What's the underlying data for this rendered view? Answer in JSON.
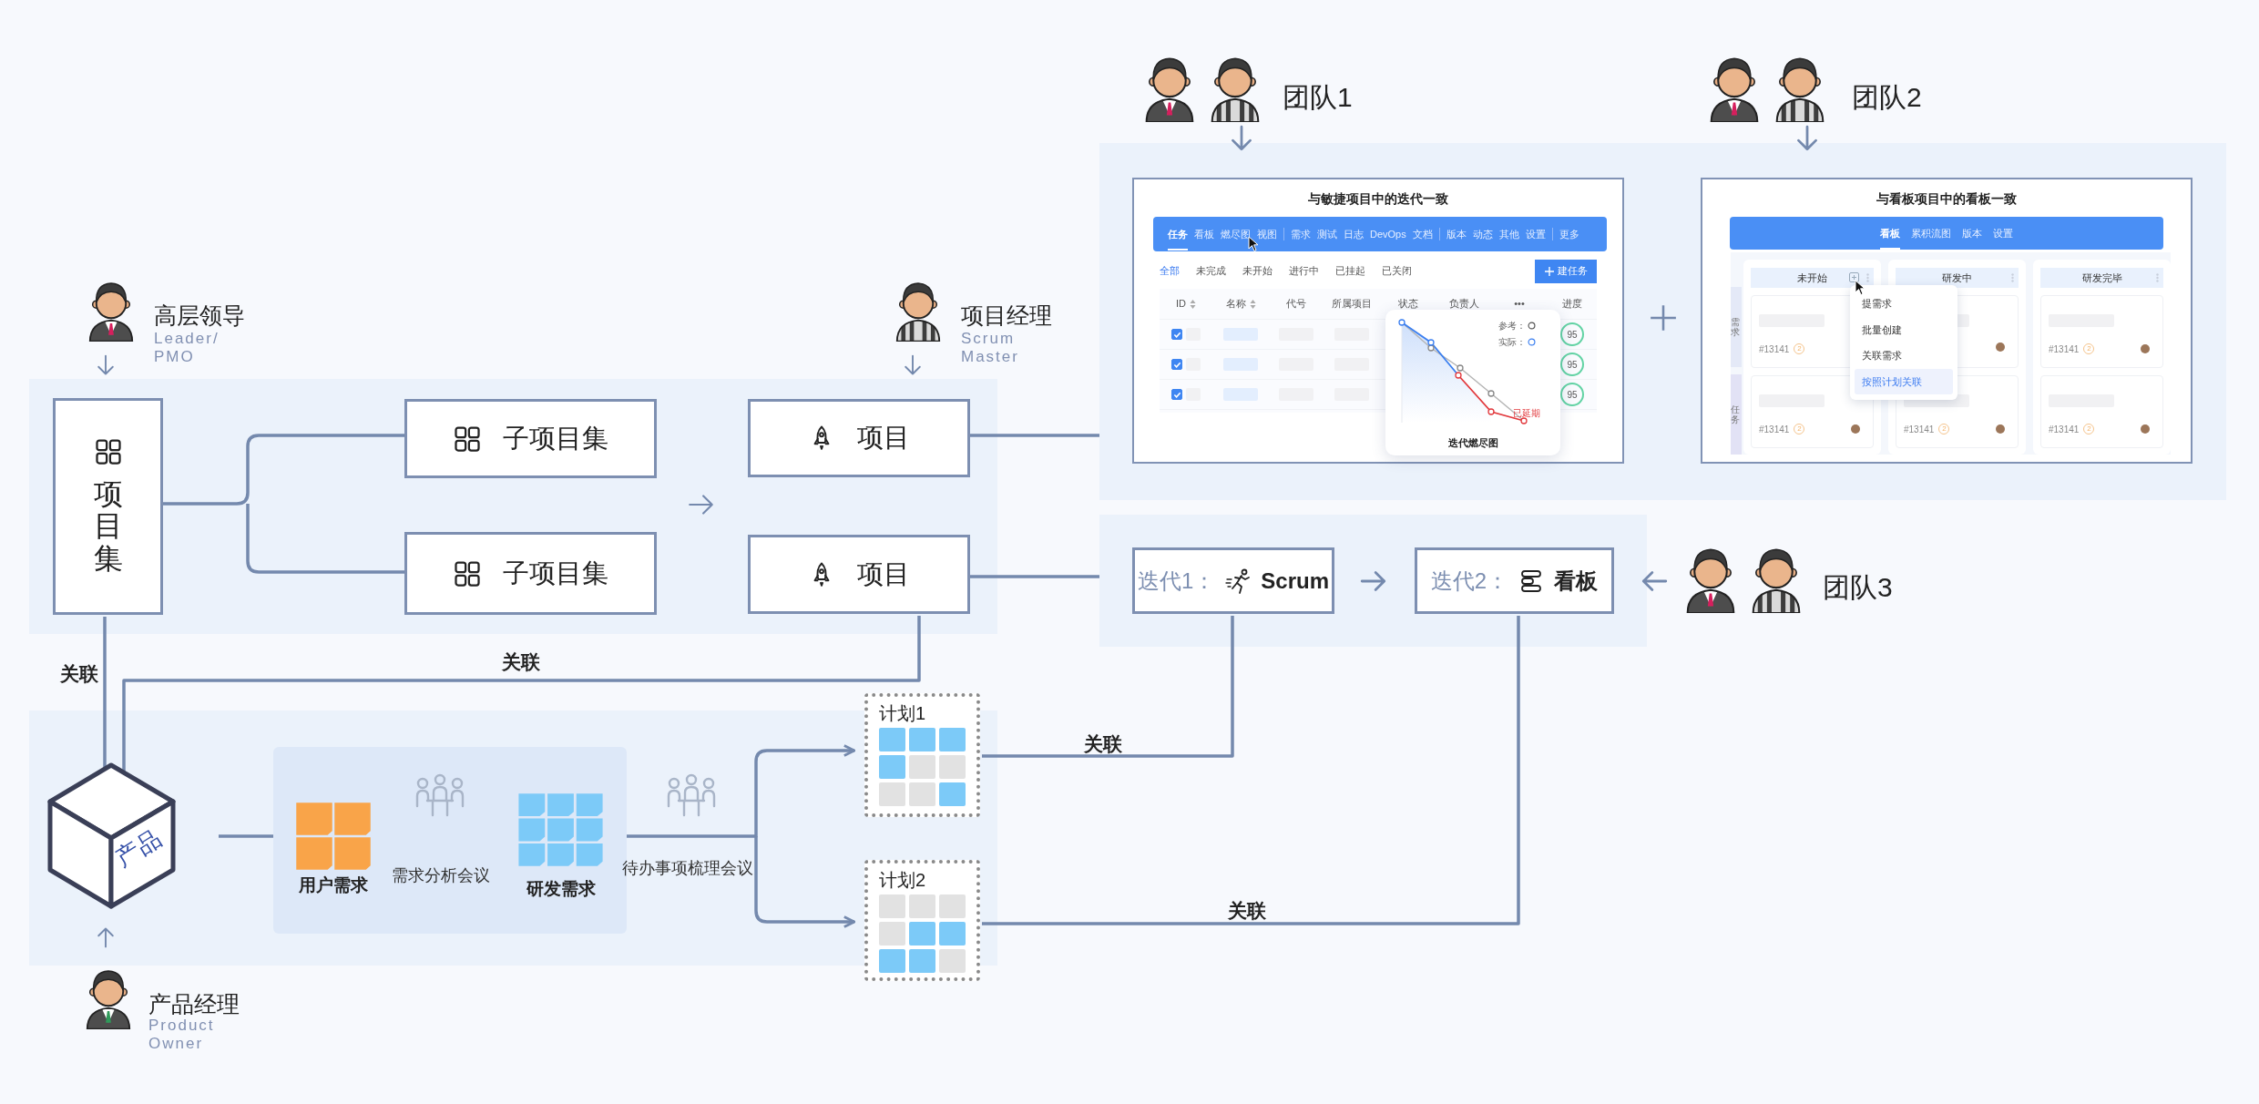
{
  "roles": [
    {
      "title": "高层领导",
      "subtitle": [
        "Leader/",
        "PMO"
      ]
    },
    {
      "title": "项目经理",
      "subtitle": [
        "Scrum",
        "Master"
      ]
    },
    {
      "title": "产品经理",
      "subtitle": [
        "Product",
        "Owner"
      ]
    }
  ],
  "teams": [
    {
      "label": "团队1"
    },
    {
      "label": "团队2"
    },
    {
      "label": "团队3"
    }
  ],
  "program": {
    "label": "项目集"
  },
  "sub_programs": [
    {
      "label": "子项目集"
    },
    {
      "label": "子项目集"
    }
  ],
  "projects": [
    {
      "label": "项目"
    },
    {
      "label": "项目"
    }
  ],
  "agile_view": {
    "title": "与敏捷项目中的迭代一致",
    "tab_groups": [
      [
        {
          "label": "任务",
          "selected": true
        },
        {
          "label": "看板",
          "selected": false
        },
        {
          "label": "燃尽图",
          "selected": false
        },
        {
          "label": "视图",
          "selected": false
        }
      ],
      [
        {
          "label": "需求",
          "selected": false
        },
        {
          "label": "测试",
          "selected": false
        },
        {
          "label": "日志",
          "selected": false
        },
        {
          "label": "DevOps",
          "selected": false
        },
        {
          "label": "文档",
          "selected": false
        }
      ],
      [
        {
          "label": "版本",
          "selected": false
        },
        {
          "label": "动态",
          "selected": false
        },
        {
          "label": "其他",
          "selected": false
        },
        {
          "label": "设置",
          "selected": false
        }
      ],
      [
        {
          "label": "更多",
          "selected": false
        }
      ]
    ],
    "filters": [
      {
        "label": "全部",
        "selected": true
      },
      {
        "label": "未完成",
        "selected": false
      },
      {
        "label": "未开始",
        "selected": false
      },
      {
        "label": "进行中",
        "selected": false
      },
      {
        "label": "已挂起",
        "selected": false
      },
      {
        "label": "已关闭",
        "selected": false
      }
    ],
    "new_button": "建任务",
    "columns": [
      "ID",
      "名称",
      "代号",
      "所属项目",
      "状态",
      "负责人",
      "•••",
      "进度"
    ],
    "rows": [
      {
        "checked": true,
        "progress": "95"
      },
      {
        "checked": true,
        "progress": "95"
      },
      {
        "checked": true,
        "progress": "95"
      }
    ],
    "burndown": {
      "title": "迭代燃尽图",
      "legend": [
        "参考：",
        "实际："
      ],
      "overdue": "已延期"
    }
  },
  "kanban_view": {
    "title": "与看板项目中的看板一致",
    "tabs": [
      {
        "label": "看板",
        "selected": true
      },
      {
        "label": "累积流图",
        "selected": false
      },
      {
        "label": "版本",
        "selected": false
      },
      {
        "label": "设置",
        "selected": false
      }
    ],
    "lanes": [
      "需求",
      "任务"
    ],
    "columns": [
      {
        "label": "未开始",
        "add_icon": true,
        "cards": [
          {
            "kind": "task",
            "id": "#13141",
            "count": "2"
          },
          {
            "kind": "task",
            "id": "#13141",
            "count": "2"
          }
        ]
      },
      {
        "label": "研发中",
        "add_icon": false,
        "cards": [
          {
            "kind": "covered"
          },
          {
            "kind": "task",
            "id": "#13141",
            "count": "2"
          }
        ]
      },
      {
        "label": "研发完毕",
        "add_icon": false,
        "cards": [
          {
            "kind": "task",
            "id": "#13141",
            "count": "2"
          },
          {
            "kind": "task",
            "id": "#13141",
            "count": "2"
          }
        ]
      }
    ],
    "menu": [
      {
        "label": "提需求",
        "selected": false
      },
      {
        "label": "批量创建",
        "selected": false
      },
      {
        "label": "关联需求",
        "selected": false
      },
      {
        "label": "按照计划关联",
        "selected": true
      }
    ]
  },
  "iterations": [
    {
      "label": "迭代1：",
      "name": "Scrum",
      "kind": "scrum"
    },
    {
      "label": "迭代2：",
      "name": "看板",
      "kind": "kanban"
    }
  ],
  "product": {
    "label": "产品"
  },
  "requirements": {
    "user": "用户需求",
    "dev": "研发需求"
  },
  "meetings": [
    "需求分析会议",
    "待办事项梳理会议"
  ],
  "plans": [
    {
      "label": "计划1",
      "notes": [
        {
          "color": "#7ccaf8"
        },
        {
          "color": "#7ccaf8"
        },
        {
          "color": "#7ccaf8"
        },
        {
          "color": "#7ccaf8"
        },
        {
          "color": "#e2e2e2"
        },
        {
          "color": "#e2e2e2"
        },
        {
          "color": "#e2e2e2"
        },
        {
          "color": "#e2e2e2"
        },
        {
          "color": "#7ccaf8"
        }
      ]
    },
    {
      "label": "计划2",
      "notes": [
        {
          "color": "#e2e2e2"
        },
        {
          "color": "#e2e2e2"
        },
        {
          "color": "#e2e2e2"
        },
        {
          "color": "#e2e2e2"
        },
        {
          "color": "#7ccaf8"
        },
        {
          "color": "#7ccaf8"
        },
        {
          "color": "#7ccaf8"
        },
        {
          "color": "#7ccaf8"
        },
        {
          "color": "#e2e2e2"
        }
      ]
    }
  ],
  "links": [
    "关联",
    "关联",
    "关联",
    "关联"
  ]
}
